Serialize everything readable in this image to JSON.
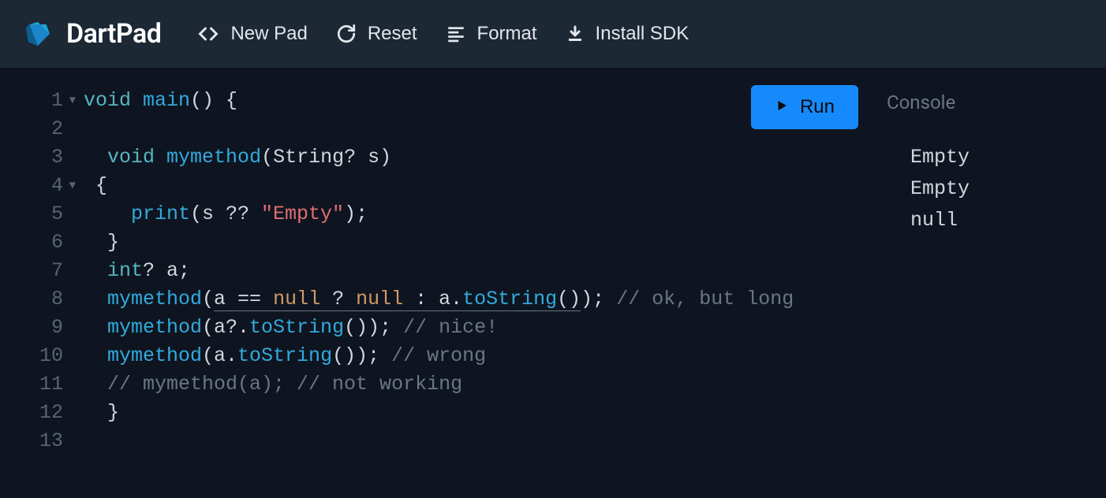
{
  "header": {
    "app_name": "DartPad",
    "buttons": {
      "new_pad": "New Pad",
      "reset": "Reset",
      "format": "Format",
      "install_sdk": "Install SDK"
    }
  },
  "run_label": "Run",
  "code": {
    "line_numbers": [
      "1",
      "2",
      "3",
      "4",
      "5",
      "6",
      "7",
      "8",
      "9",
      "10",
      "11",
      "12",
      "13"
    ],
    "fold_markers": [
      0,
      3
    ],
    "tokens": {
      "l1": {
        "kw": "void",
        "fn": "main",
        "rest": "() {"
      },
      "l3": {
        "indent": "  ",
        "kw": "void",
        "fn": "mymethod",
        "params": "(String? s)"
      },
      "l4": {
        "text": " {"
      },
      "l5": {
        "indent": "    ",
        "fn": "print",
        "open": "(s ?? ",
        "str": "\"Empty\"",
        "close": ");"
      },
      "l6": {
        "text": "  }"
      },
      "l7": {
        "type": "  int",
        "rest": "? a;"
      },
      "l8": {
        "fn": "  mymethod",
        "open": "(",
        "hint": "a == ",
        "null1": "null",
        "hint2": " ? ",
        "null2": "null",
        "hint3": " : a.",
        "to": "toString",
        "hint4": "()",
        "close": "); ",
        "comment": "// ok, but long"
      },
      "l9": {
        "fn": "  mymethod",
        "open": "(a?.",
        "to": "toString",
        "close": "()); ",
        "comment": "// nice!"
      },
      "l10": {
        "fn": "  mymethod",
        "open": "(a.",
        "to": "toString",
        "close": "()); ",
        "comment": "// wrong"
      },
      "l11": {
        "comment": "  // mymethod(a); // not working"
      },
      "l12": {
        "text": "  }"
      }
    }
  },
  "console": {
    "title": "Console",
    "output": [
      "Empty",
      "Empty",
      "null"
    ]
  }
}
